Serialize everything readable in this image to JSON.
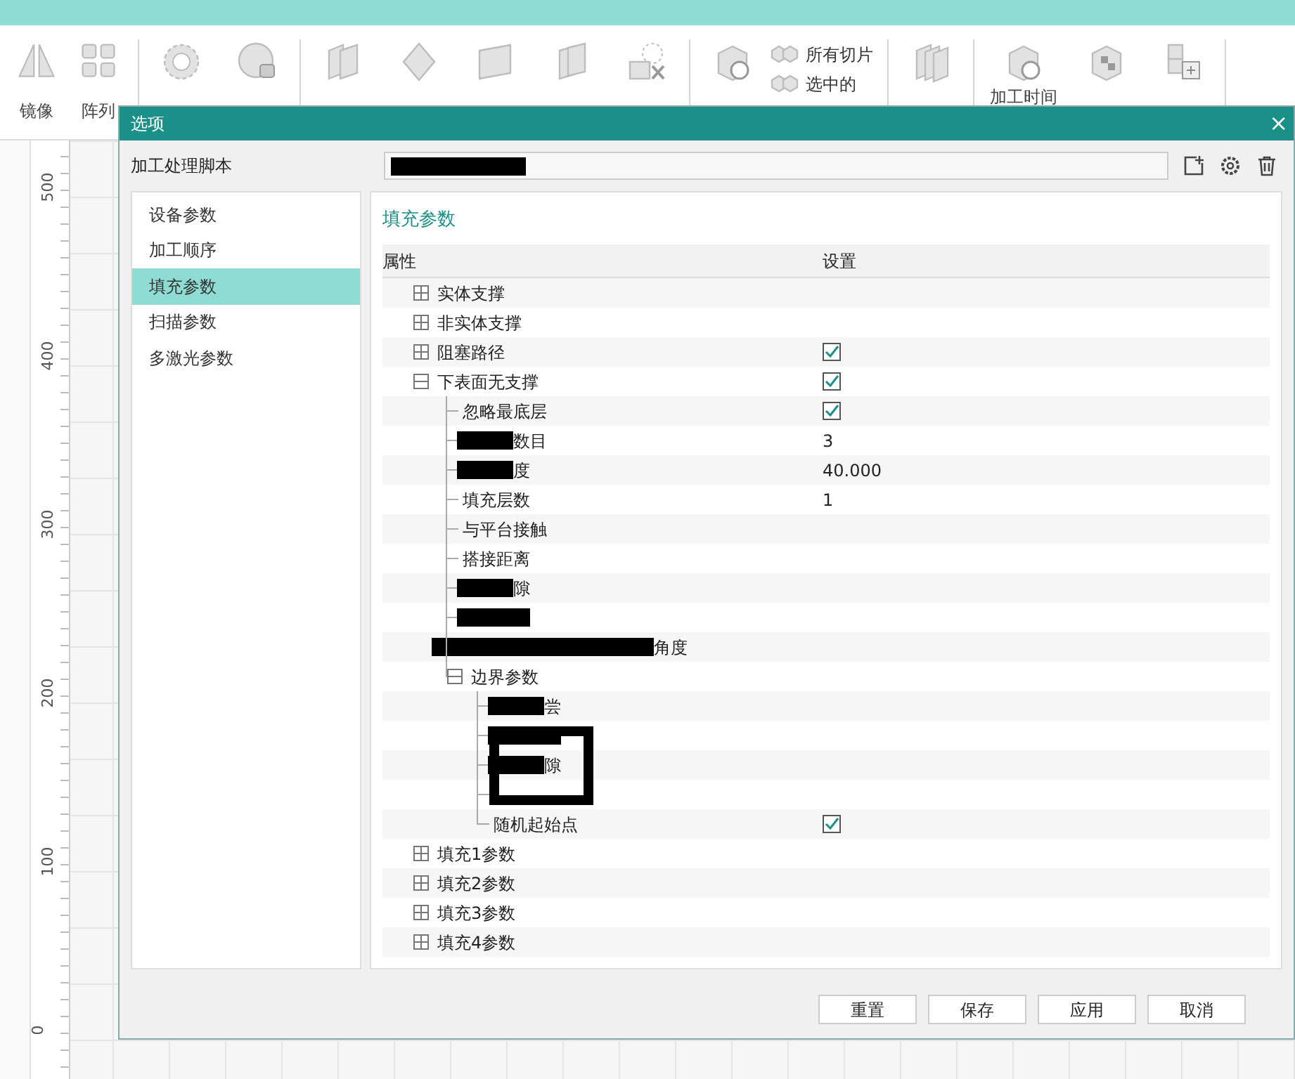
{
  "toolbar": {
    "groups": [
      {
        "items": [
          {
            "kind": "big",
            "label": "镜像"
          },
          {
            "kind": "big",
            "label": "阵列"
          }
        ]
      },
      {
        "items": [
          {
            "kind": "icon"
          },
          {
            "kind": "icon"
          }
        ]
      },
      {
        "items": [
          {
            "kind": "icon"
          },
          {
            "kind": "icon"
          },
          {
            "kind": "icon"
          },
          {
            "kind": "icon"
          },
          {
            "kind": "icon"
          }
        ]
      },
      {
        "items": [
          {
            "kind": "icon"
          },
          {
            "kind": "small",
            "label": "所有切片"
          },
          {
            "kind": "small",
            "label": "选中的"
          }
        ]
      },
      {
        "items": [
          {
            "kind": "icon"
          }
        ]
      },
      {
        "items": [
          {
            "kind": "top",
            "label": "加工时间"
          },
          {
            "kind": "icon"
          },
          {
            "kind": "icon"
          }
        ]
      }
    ]
  },
  "ruler": {
    "labels": [
      "500",
      "400",
      "300",
      "200",
      "100",
      "0"
    ]
  },
  "dialog": {
    "title": "选项",
    "close": "×",
    "script": {
      "label": "加工处理脚本",
      "redacted": true
    },
    "nav": [
      {
        "label": "设备参数",
        "selected": false
      },
      {
        "label": "加工顺序",
        "selected": false
      },
      {
        "label": "填充参数",
        "selected": true
      },
      {
        "label": "扫描参数",
        "selected": false
      },
      {
        "label": "多激光参数",
        "selected": false
      }
    ],
    "panel_title": "填充参数",
    "columns": [
      "属性",
      "设置"
    ],
    "rows": [
      {
        "label": "实体支撑",
        "expanded": false,
        "children": []
      },
      {
        "label": "非实体支撑",
        "expanded": false,
        "children": []
      },
      {
        "label": "阻塞路径",
        "expanded": false,
        "kind": "checkbox",
        "checked": true,
        "children": []
      },
      {
        "label": "下表面无支撑",
        "expanded": true,
        "kind": "checkbox",
        "checked": true,
        "children": [
          {
            "label": "忽略最底层",
            "kind": "checkbox",
            "checked": true
          },
          {
            "label": "数目",
            "redacted": true,
            "kind": "text",
            "value": "3"
          },
          {
            "label": "度",
            "redacted": true,
            "kind": "text",
            "value": "40.000"
          },
          {
            "label": "填充层数",
            "kind": "text",
            "value": "1"
          },
          {
            "label": "与平台接触"
          },
          {
            "label": "搭接距离"
          },
          {
            "label": "隙",
            "redacted": true
          },
          {
            "redacted": true
          },
          {
            "label": "角度",
            "redacted": true,
            "wide": true
          },
          {
            "label": "边界参数",
            "expanded": true,
            "children": [
              {
                "label": "尝",
                "redacted": true
              },
              {
                "redacted": true
              },
              {
                "label": "隙",
                "redacted": true
              },
              {
                "framed": true
              },
              {
                "label": "随机起始点",
                "kind": "checkbox",
                "checked": true
              }
            ]
          }
        ]
      },
      {
        "label": "填充1参数",
        "expanded": false,
        "children": []
      },
      {
        "label": "填充2参数",
        "expanded": false,
        "children": []
      },
      {
        "label": "填充3参数",
        "expanded": false,
        "children": []
      },
      {
        "label": "填充4参数",
        "expanded": false,
        "children": []
      }
    ],
    "buttons": [
      "重置",
      "保存",
      "应用",
      "取消"
    ]
  }
}
